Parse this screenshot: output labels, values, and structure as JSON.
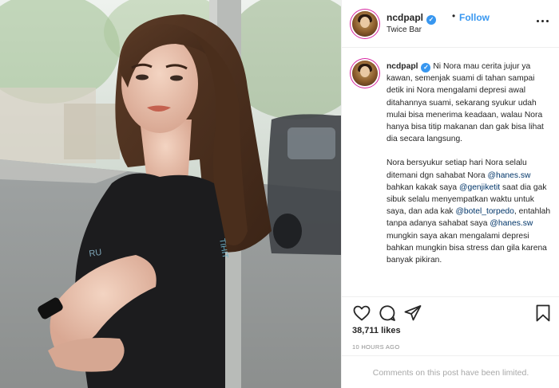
{
  "post": {
    "header": {
      "username": "ncdpapl",
      "verified_icon": "verified-badge-icon",
      "dot": "•",
      "follow_label": "Follow",
      "location": "Twice Bar",
      "more_icon": "more-options-icon"
    },
    "caption": {
      "username": "ncdpapl",
      "paragraph1": "Ni Nora mau cerita jujur ya kawan, semenjak suami di tahan sampai detik ini Nora mengalami depresi awal ditahannya suami, sekarang syukur udah mulai bisa menerima keadaan, walau Nora hanya bisa titip makanan dan gak bisa lihat dia secara langsung.",
      "p2_a": "Nora bersyukur setiap hari Nora selalu ditemani dgn sahabat Nora ",
      "p2_mention1": "@hanes.sw",
      "p2_b": " bahkan kakak saya ",
      "p2_mention2": "@genjiketit",
      "p2_c": " saat dia gak sibuk selalu menyempatkan waktu untuk saya, dan ada kak ",
      "p2_mention3": "@botel_torpedo",
      "p2_d": ", entahlah tanpa adanya sahabat saya ",
      "p2_mention4": "@hanes.sw",
      "p2_e": " mungkin saya akan mengalami depresi bahkan mungkin bisa stress dan gila karena banyak pikiran."
    },
    "actions": {
      "like_icon": "heart-icon",
      "comment_icon": "comment-icon",
      "share_icon": "share-icon",
      "save_icon": "bookmark-icon"
    },
    "likes": "38,711 likes",
    "time_ago": "10 HOURS AGO",
    "comments_limited": "Comments on this post have been limited.",
    "colors": {
      "link_blue": "#3897f0",
      "mention": "#003569",
      "muted": "#8e8e8e",
      "border": "#efefef"
    }
  }
}
